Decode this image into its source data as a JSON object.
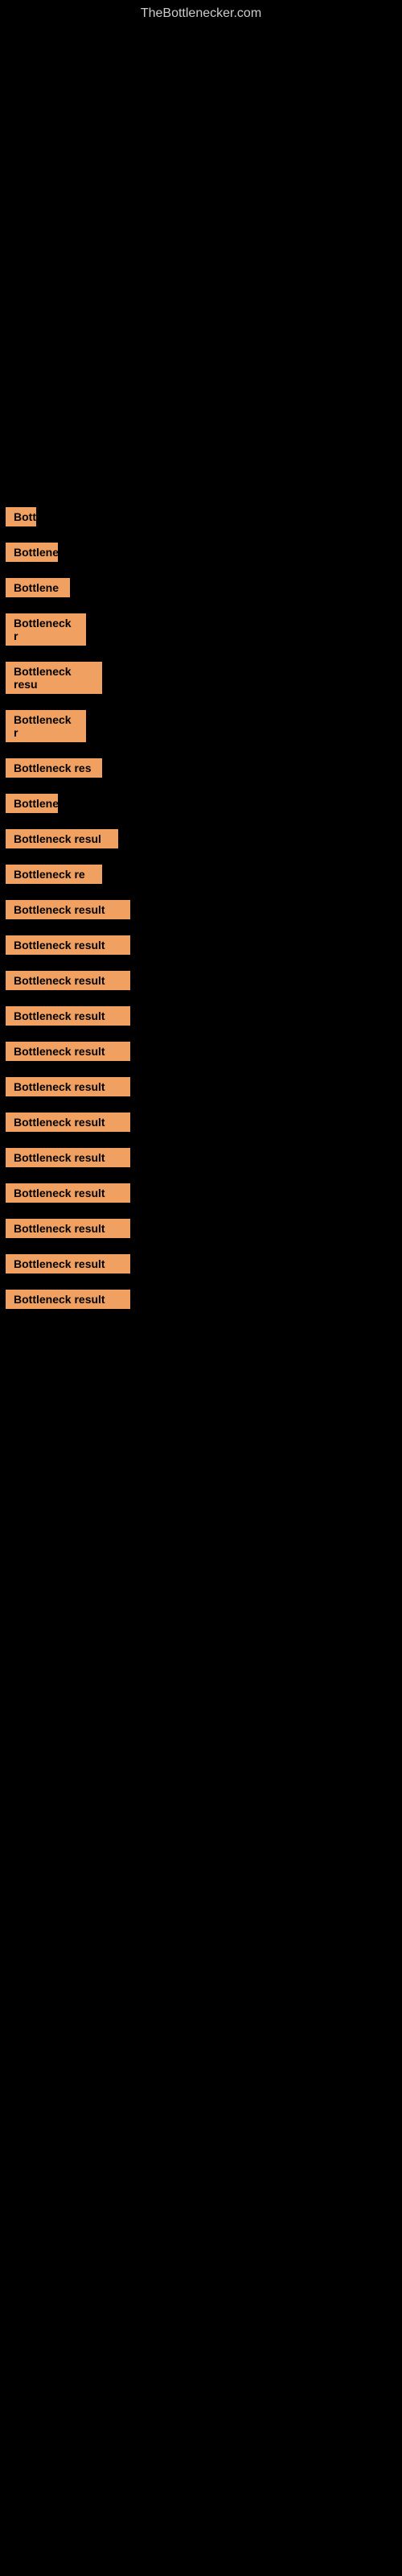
{
  "site": {
    "title": "TheBottlenecker.com"
  },
  "results": [
    {
      "label": "Bottle",
      "width_class": "w-tiny"
    },
    {
      "label": "Bottleneck",
      "width_class": "w-small"
    },
    {
      "label": "Bottlene",
      "width_class": "w-med-sm"
    },
    {
      "label": "Bottleneck r",
      "width_class": "w-med"
    },
    {
      "label": "Bottleneck resu",
      "width_class": "w-med-lg"
    },
    {
      "label": "Bottleneck r",
      "width_class": "w-med"
    },
    {
      "label": "Bottleneck res",
      "width_class": "w-med-lg"
    },
    {
      "label": "Bottleneck",
      "width_class": "w-small"
    },
    {
      "label": "Bottleneck resul",
      "width_class": "w-large"
    },
    {
      "label": "Bottleneck re",
      "width_class": "w-med-lg"
    },
    {
      "label": "Bottleneck result",
      "width_class": "w-xlarge"
    },
    {
      "label": "Bottleneck result",
      "width_class": "w-xlarge"
    },
    {
      "label": "Bottleneck result",
      "width_class": "w-xlarge"
    },
    {
      "label": "Bottleneck result",
      "width_class": "w-xlarge"
    },
    {
      "label": "Bottleneck result",
      "width_class": "w-xlarge"
    },
    {
      "label": "Bottleneck result",
      "width_class": "w-xlarge"
    },
    {
      "label": "Bottleneck result",
      "width_class": "w-xlarge"
    },
    {
      "label": "Bottleneck result",
      "width_class": "w-xlarge"
    },
    {
      "label": "Bottleneck result",
      "width_class": "w-xlarge"
    },
    {
      "label": "Bottleneck result",
      "width_class": "w-xlarge"
    },
    {
      "label": "Bottleneck result",
      "width_class": "w-xlarge"
    },
    {
      "label": "Bottleneck result",
      "width_class": "w-xlarge"
    }
  ]
}
